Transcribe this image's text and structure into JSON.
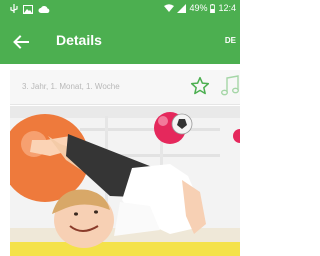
{
  "status_bar": {
    "left_icons": [
      "usb-icon",
      "image-icon",
      "cloud-icon"
    ],
    "right_icons": [
      "wifi-icon",
      "signal-icon",
      "battery-icon"
    ],
    "battery": "49%",
    "time": "12:4"
  },
  "app_bar": {
    "title": "Details",
    "action_label": "DE",
    "background": "#4CAF50"
  },
  "info": {
    "week_text": "3. Jahr, 1. Monat, 1. Woche",
    "icons": [
      "star-outline-icon",
      "music-note-icon"
    ]
  },
  "colors": {
    "accent": "#4CAF50"
  }
}
